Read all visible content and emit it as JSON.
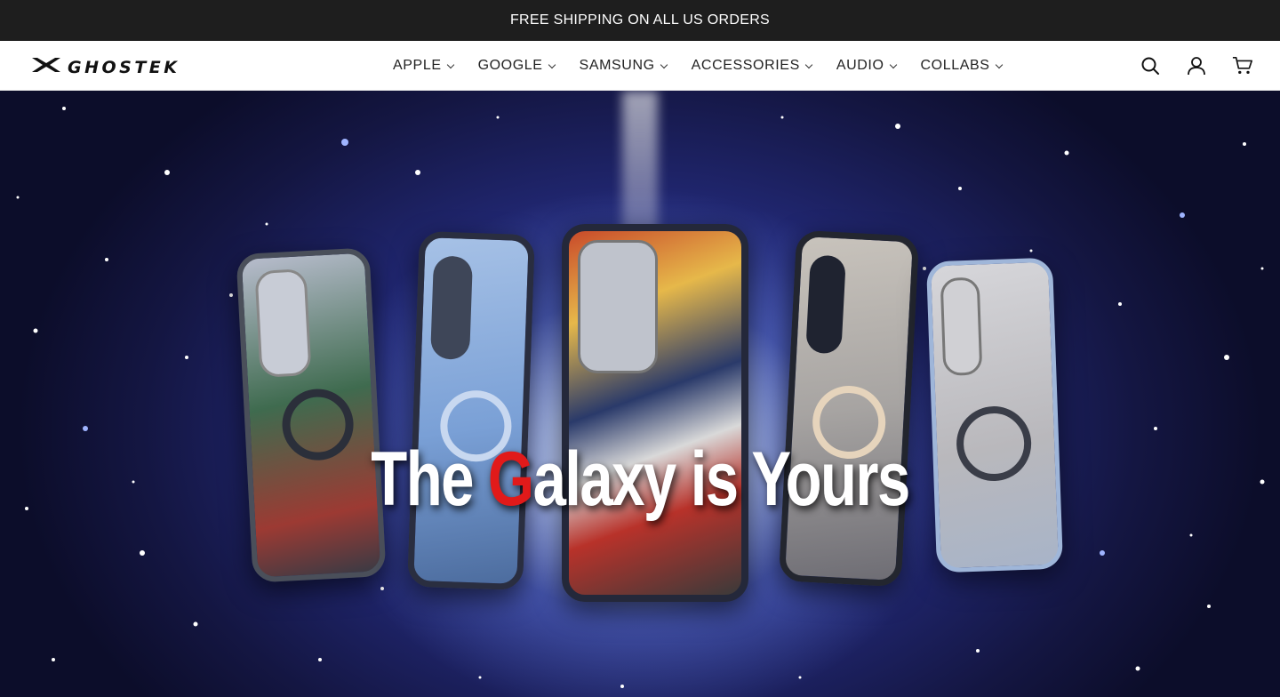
{
  "announcement": {
    "text": "FREE SHIPPING ON ALL US ORDERS"
  },
  "brand": {
    "name": "GHOSTEK"
  },
  "nav": {
    "items": [
      {
        "label": "APPLE"
      },
      {
        "label": "GOOGLE"
      },
      {
        "label": "SAMSUNG"
      },
      {
        "label": "ACCESSORIES"
      },
      {
        "label": "AUDIO"
      },
      {
        "label": "COLLABS"
      }
    ]
  },
  "header_icons": [
    "search-icon",
    "account-icon",
    "cart-icon"
  ],
  "hero": {
    "headline_prefix": "The ",
    "headline_glyph": "G",
    "headline_suffix": "alaxy is Yours"
  },
  "colors": {
    "announcement_bg": "#1e1e1e",
    "accent_red": "#e11a1a",
    "hero_deep": "#141642"
  }
}
